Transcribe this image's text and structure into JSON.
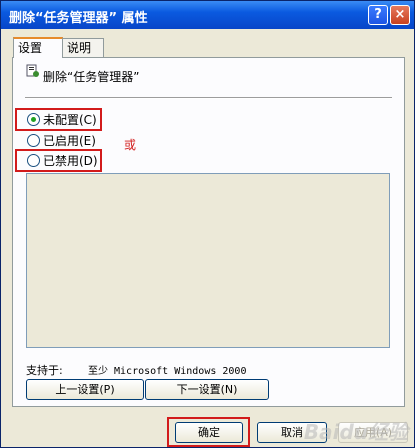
{
  "window": {
    "title": "删除“任务管理器” 属性",
    "help_glyph": "?",
    "close_glyph": "×"
  },
  "tabs": [
    {
      "label": "设置",
      "active": true
    },
    {
      "label": "说明",
      "active": false
    }
  ],
  "policy": {
    "name": "删除“任务管理器”"
  },
  "options": [
    {
      "label": "未配置(C)",
      "selected": true
    },
    {
      "label": "已启用(E)",
      "selected": false
    },
    {
      "label": "已禁用(D)",
      "selected": false
    }
  ],
  "annotation": {
    "or_text": "或",
    "highlight_color": "#d21b1b"
  },
  "supported": {
    "label": "支持于:",
    "value": "至少 Microsoft Windows 2000"
  },
  "nav": {
    "prev": "上一设置(P)",
    "next": "下一设置(N)"
  },
  "footer": {
    "ok": "确定",
    "cancel": "取消",
    "apply": "应用(A)"
  },
  "watermark": "Baidu经验"
}
